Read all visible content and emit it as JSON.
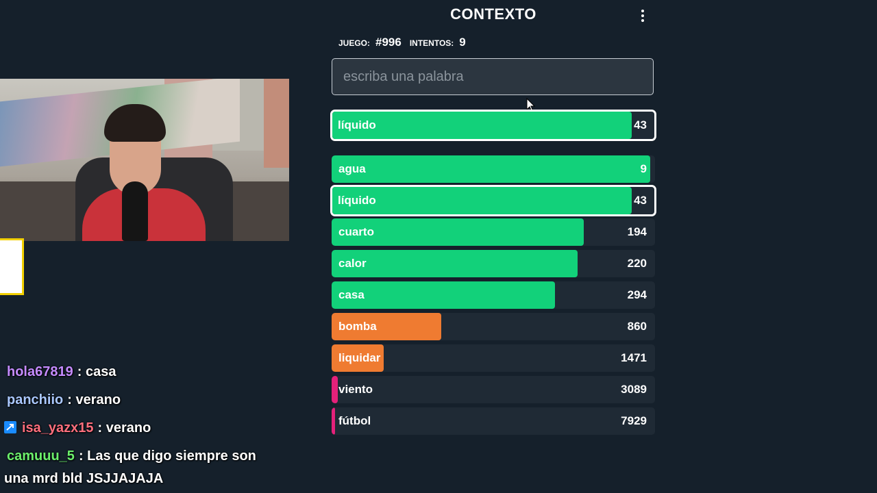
{
  "header": {
    "title": "CONTEXTO",
    "menu_icon": "vertical-dots-icon"
  },
  "stats": {
    "game_label": "JUEGO:",
    "game_value": "#996",
    "attempts_label": "INTENTOS:",
    "attempts_value": "9"
  },
  "search": {
    "placeholder": "escriba una palabra"
  },
  "colors": {
    "green": "#12d17a",
    "orange": "#ef7b31",
    "pink": "#e4217a",
    "background": "#15202b",
    "row_background": "#1f2a35"
  },
  "last_guess": {
    "word": "líquido",
    "rank": "43",
    "color": "green",
    "fill": 0.93
  },
  "guesses": [
    {
      "word": "agua",
      "rank": "9",
      "color": "green",
      "fill": 0.985
    },
    {
      "word": "líquido",
      "rank": "43",
      "color": "green",
      "fill": 0.93,
      "highlighted": true
    },
    {
      "word": "cuarto",
      "rank": "194",
      "color": "green",
      "fill": 0.78
    },
    {
      "word": "calor",
      "rank": "220",
      "color": "green",
      "fill": 0.76
    },
    {
      "word": "casa",
      "rank": "294",
      "color": "green",
      "fill": 0.69
    },
    {
      "word": "bomba",
      "rank": "860",
      "color": "orange",
      "fill": 0.34
    },
    {
      "word": "liquidar",
      "rank": "1471",
      "color": "orange",
      "fill": 0.16
    },
    {
      "word": "viento",
      "rank": "3089",
      "color": "pink",
      "fill": 0.02
    },
    {
      "word": "fútbol",
      "rank": "7929",
      "color": "pink",
      "fill": 0.01
    }
  ],
  "chat": [
    {
      "user": "hola67819",
      "color": "#c58bff",
      "message": ": casa"
    },
    {
      "user": "panchiio",
      "color": "#aac8ff",
      "message": ": verano"
    },
    {
      "user": "isa_yazx15",
      "color": "#ff6f7d",
      "message": ": verano",
      "badge": "prime-badge-icon"
    },
    {
      "user": "camuuu_5",
      "color": "#6cf06c",
      "message": ": Las que digo siempre son",
      "message_line2": "una mrd bld JSJJAJAJA"
    }
  ]
}
